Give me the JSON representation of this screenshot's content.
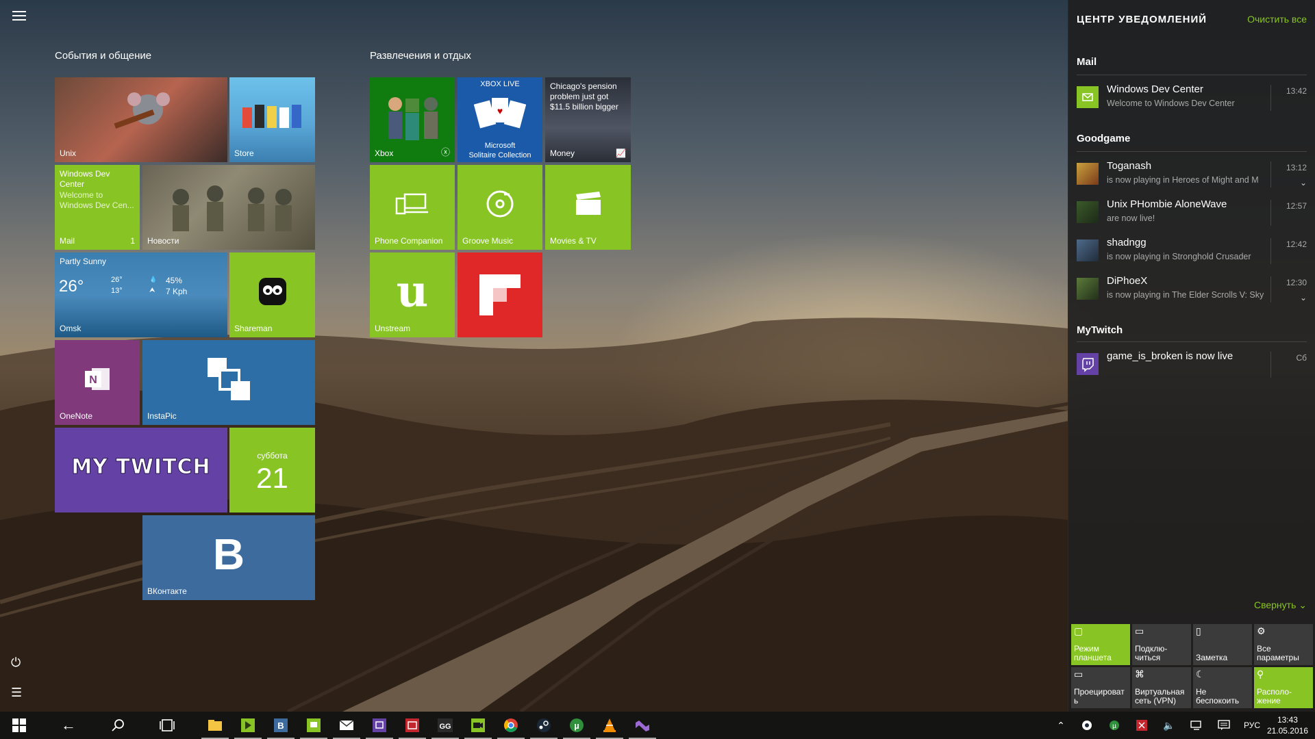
{
  "start": {
    "groups": [
      {
        "title": "События и общение"
      },
      {
        "title": "Развлечения и отдых"
      }
    ],
    "tiles": {
      "unix": {
        "label": "Unix"
      },
      "store": {
        "label": "Store"
      },
      "mail": {
        "label": "Mail",
        "count": "1",
        "line1": "Windows Dev Center",
        "line2": "Welcome to Windows Dev Cen..."
      },
      "news": {
        "label": "Новости"
      },
      "weather": {
        "condition": "Partly Sunny",
        "temp": "26°",
        "high": "26°",
        "low": "13°",
        "humidity": "45%",
        "wind": "7 Kph",
        "city": "Omsk"
      },
      "shareman": {
        "label": "Shareman"
      },
      "onenote": {
        "label": "OneNote"
      },
      "instapic": {
        "label": "InstaPic"
      },
      "mytwitch": {
        "label": "MY TWITCH"
      },
      "calendar": {
        "day_name": "суббота",
        "day": "21"
      },
      "vk": {
        "label": "ВКонтакте",
        "glyph": "B"
      },
      "xbox": {
        "label": "Xbox"
      },
      "solitaire": {
        "badge": "XBOX LIVE",
        "line1": "Microsoft",
        "line2": "Solitaire Collection"
      },
      "money": {
        "label": "Money",
        "headline": "Chicago's pension problem just got $11.5 billion bigger"
      },
      "phone": {
        "label": "Phone Companion"
      },
      "groove": {
        "label": "Groove Music"
      },
      "movies": {
        "label": "Movies & TV"
      },
      "unstream": {
        "label": "Unstream",
        "glyph": "u"
      },
      "flipboard": {
        "label": ""
      }
    }
  },
  "action_center": {
    "title": "ЦЕНТР УВЕДОМЛЕНИЙ",
    "clear_all": "Очистить все",
    "collapse": "Свернуть",
    "groups": [
      {
        "name": "Mail",
        "items": [
          {
            "title": "Windows Dev Center",
            "text": "Welcome to Windows Dev Center",
            "time": "13:42"
          }
        ]
      },
      {
        "name": "Goodgame",
        "items": [
          {
            "title": "Toganash",
            "text": "is now playing in Heroes of Might and M",
            "time": "13:12"
          },
          {
            "title": "Unix PHombie AloneWave",
            "text": "are now live!",
            "time": "12:57"
          },
          {
            "title": "shadngg",
            "text": "is now playing in Stronghold Crusader",
            "time": "12:42"
          },
          {
            "title": "DiPhoeX",
            "text": "is now playing in The Elder Scrolls V: Sky",
            "time": "12:30"
          }
        ]
      },
      {
        "name": "MyTwitch",
        "items": [
          {
            "title": "game_is_broken is now live",
            "text": "",
            "time": "Сб"
          }
        ]
      }
    ],
    "quick_actions": [
      {
        "label": "Режим\nпланшета",
        "icon": "tablet-icon",
        "on": true
      },
      {
        "label": "Подклю-\nчиться",
        "icon": "connect-icon",
        "on": false
      },
      {
        "label": "Заметка",
        "icon": "note-icon",
        "on": false
      },
      {
        "label": "Все\nпараметры",
        "icon": "gear-icon",
        "on": false
      },
      {
        "label": "Проецироват\nь",
        "icon": "project-icon",
        "on": false
      },
      {
        "label": "Виртуальная\nсеть (VPN)",
        "icon": "vpn-icon",
        "on": false
      },
      {
        "label": "Не\nбеспокоить",
        "icon": "moon-icon",
        "on": false
      },
      {
        "label": "Располо-\nжение",
        "icon": "location-icon",
        "on": true
      }
    ]
  },
  "taskbar": {
    "language": "РУС",
    "time": "13:43",
    "date": "21.05.2016"
  },
  "colors": {
    "accent": "#88c524",
    "onenote": "#80397b",
    "instapic": "#2c6ea5",
    "twitch": "#6441a4",
    "vk": "#3e6b9e",
    "flipboard": "#e12828",
    "xbox": "#107c10"
  }
}
